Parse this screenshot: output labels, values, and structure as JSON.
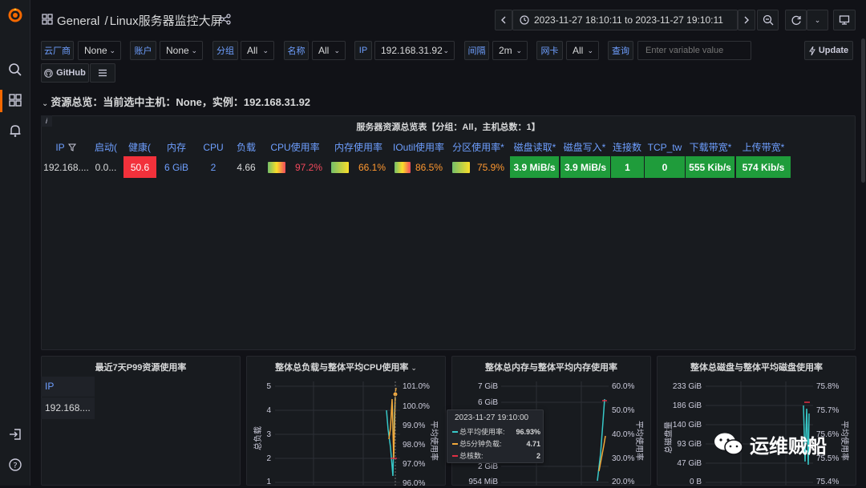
{
  "header": {
    "breadcrumb_root": "General",
    "breadcrumb_sep": "/",
    "title": "Linux服务器监控大屏",
    "time_range": "2023-11-27 18:10:11 to 2023-11-27 19:10:11"
  },
  "variables": [
    {
      "label": "云厂商",
      "value": "None"
    },
    {
      "label": "账户",
      "value": "None"
    },
    {
      "label": "分组",
      "value": "All"
    },
    {
      "label": "名称",
      "value": "All"
    },
    {
      "label": "IP",
      "value": "192.168.31.92"
    },
    {
      "label": "间隔",
      "value": "2m"
    },
    {
      "label": "网卡",
      "value": "All"
    },
    {
      "label": "查询",
      "placeholder": "Enter variable value"
    }
  ],
  "update_label": "Update",
  "github_label": "GitHub",
  "row_title": "资源总览：当前选中主机：None，实例：192.168.31.92",
  "overview_table": {
    "title": "服务器资源总览表【分组：All，主机总数：1】",
    "info_icon": "i",
    "headers": [
      "IP",
      "启动(",
      "健康(",
      "内存",
      "CPU",
      "负载",
      "CPU使用率",
      "内存使用率",
      "IOutil使用率",
      "分区使用率*",
      "磁盘读取*",
      "磁盘写入*",
      "连接数",
      "TCP_tw",
      "下载带宽*",
      "上传带宽*"
    ],
    "row": [
      "192.168....",
      "0.0...",
      "50.6",
      "6 GiB",
      "2",
      "4.66",
      "97.2%",
      "66.1%",
      "86.5%",
      "75.9%",
      "3.9 MiB/s",
      "3.9 MiB/s",
      "1",
      "0",
      "555 Kib/s",
      "574 Kib/s"
    ]
  },
  "p99_panel": {
    "title": "最近7天P99资源使用率",
    "header": "IP",
    "row": "192.168...."
  },
  "chart_panels": [
    {
      "title": "整体总负载与整体平均CPU使用率",
      "left_ticks": [
        "5",
        "4",
        "3",
        "2",
        "1"
      ],
      "right_ticks": [
        "101.0%",
        "100.0%",
        "99.0%",
        "98.0%",
        "97.0%",
        "96.0%"
      ],
      "left_label": "总负载",
      "right_label": "平均使用率"
    },
    {
      "title": "整体总内存与整体平均内存使用率",
      "left_ticks": [
        "7 GiB",
        "6 GiB",
        "",
        "",
        "2 GiB",
        "954 MiB"
      ],
      "right_ticks": [
        "60.0%",
        "50.0%",
        "40.0%",
        "30.0%",
        "20.0%"
      ],
      "right_label": "平均使用率"
    },
    {
      "title": "整体总磁盘与整体平均磁盘使用率",
      "left_ticks": [
        "233 GiB",
        "186 GiB",
        "140 GiB",
        "93 GiB",
        "47 GiB",
        "0 B"
      ],
      "right_ticks": [
        "75.8%",
        "75.7%",
        "75.6%",
        "75.5%",
        "75.4%"
      ],
      "left_label": "总磁盘量",
      "right_label": "平均使用率"
    }
  ],
  "tooltip": {
    "time": "2023-11-27 19:10:00",
    "rows": [
      {
        "label": "总平均使用率:",
        "value": "96.93%",
        "color": "#37c8c8"
      },
      {
        "label": "总5分钟负载:",
        "value": "4.71",
        "color": "#f2a93b"
      },
      {
        "label": "总核数:",
        "value": "2",
        "color": "#e02f44"
      }
    ]
  },
  "watermark": {
    "text": "运维贼船"
  },
  "colors": {
    "accent_blue": "#6e9fff",
    "health_red": "#f2313b",
    "io_green": "#1f9c3b",
    "grafana_orange": "#f46800"
  }
}
